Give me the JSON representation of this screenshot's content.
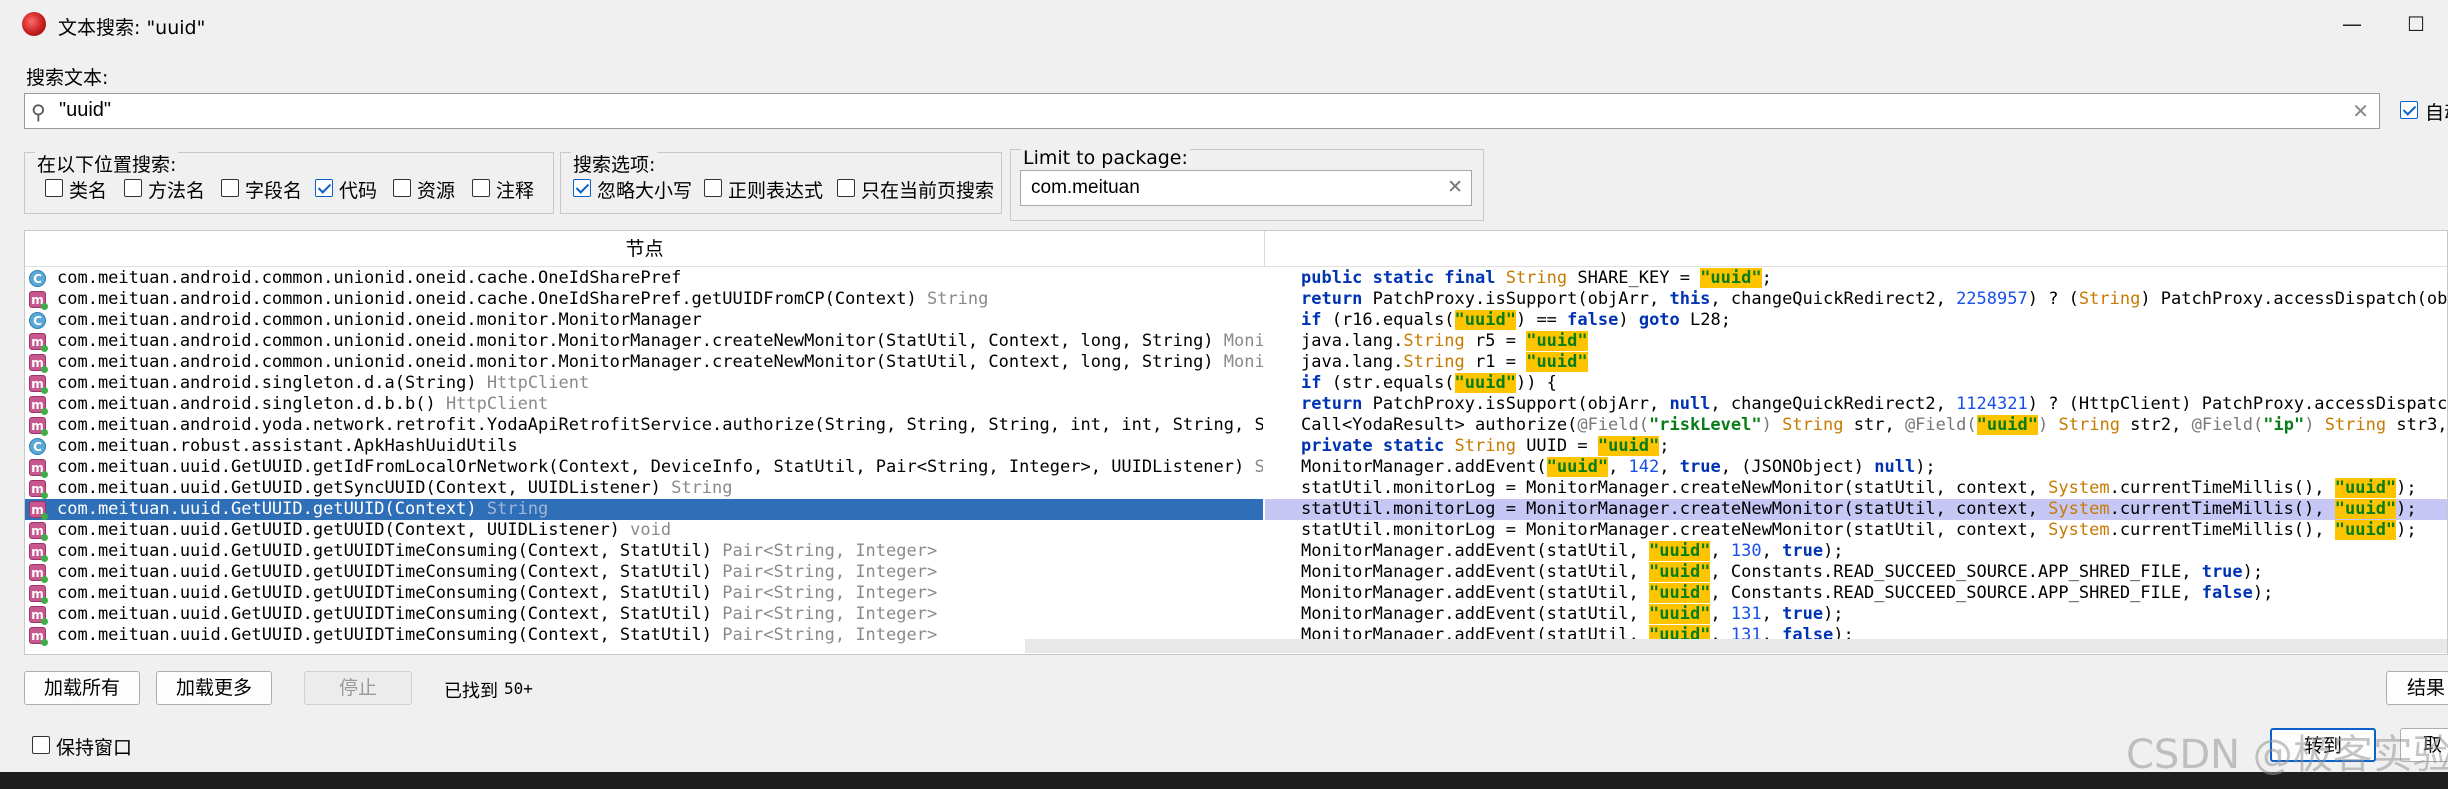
{
  "window": {
    "title": "文本搜索: \"uuid\"",
    "minimize_glyph": "—",
    "maximize_glyph": "☐"
  },
  "search": {
    "label": "搜索文本:",
    "value": "\"uuid\"",
    "auto_label": "自动"
  },
  "search_in": {
    "title": "在以下位置搜索:",
    "options": [
      {
        "label": "类名",
        "checked": false
      },
      {
        "label": "方法名",
        "checked": false
      },
      {
        "label": "字段名",
        "checked": false
      },
      {
        "label": "代码",
        "checked": true
      },
      {
        "label": "资源",
        "checked": false
      },
      {
        "label": "注释",
        "checked": false
      }
    ]
  },
  "search_options": {
    "title": "搜索选项:",
    "options": [
      {
        "label": "忽略大小写",
        "checked": true
      },
      {
        "label": "正则表达式",
        "checked": false
      },
      {
        "label": "只在当前页搜索",
        "checked": false
      }
    ]
  },
  "package": {
    "title": "Limit to package:",
    "value": "com.meituan"
  },
  "results": {
    "column_node": "节点",
    "selected_index": 11,
    "rows": [
      {
        "icon": "class",
        "name": "com.meituan.android.common.unionid.oneid.cache.OneIdSharePref",
        "type": ""
      },
      {
        "icon": "method",
        "name": "com.meituan.android.common.unionid.oneid.cache.OneIdSharePref.getUUIDFromCP(Context)",
        "type": "String"
      },
      {
        "icon": "class",
        "name": "com.meituan.android.common.unionid.oneid.monitor.MonitorManager",
        "type": ""
      },
      {
        "icon": "method",
        "name": "com.meituan.android.common.unionid.oneid.monitor.MonitorManager.createNewMonitor(StatUtil, Context, long, String)",
        "type": "Monitor"
      },
      {
        "icon": "method",
        "name": "com.meituan.android.common.unionid.oneid.monitor.MonitorManager.createNewMonitor(StatUtil, Context, long, String)",
        "type": "Monitor"
      },
      {
        "icon": "method",
        "name": "com.meituan.android.singleton.d.a(String)",
        "type": "HttpClient"
      },
      {
        "icon": "method",
        "name": "com.meituan.android.singleton.d.b.b()",
        "type": "HttpClient"
      },
      {
        "icon": "method",
        "name": "com.meituan.android.yoda.network.retrofit.YodaApiRetrofitService.authorize(String, String, String, int, int, String, Stri",
        "type": ""
      },
      {
        "icon": "class",
        "name": "com.meituan.robust.assistant.ApkHashUuidUtils",
        "type": ""
      },
      {
        "icon": "method",
        "name": "com.meituan.uuid.GetUUID.getIdFromLocalOrNetwork(Context, DeviceInfo, StatUtil, Pair<String, Integer>, UUIDListener)",
        "type": "Stri"
      },
      {
        "icon": "method",
        "name": "com.meituan.uuid.GetUUID.getSyncUUID(Context, UUIDListener)",
        "type": "String"
      },
      {
        "icon": "method",
        "name": "com.meituan.uuid.GetUUID.getUUID(Context)",
        "type": "String"
      },
      {
        "icon": "method",
        "name": "com.meituan.uuid.GetUUID.getUUID(Context, UUIDListener)",
        "type": "void"
      },
      {
        "icon": "method",
        "name": "com.meituan.uuid.GetUUID.getUUIDTimeConsuming(Context, StatUtil)",
        "type": "Pair<String, Integer>"
      },
      {
        "icon": "method",
        "name": "com.meituan.uuid.GetUUID.getUUIDTimeConsuming(Context, StatUtil)",
        "type": "Pair<String, Integer>"
      },
      {
        "icon": "method",
        "name": "com.meituan.uuid.GetUUID.getUUIDTimeConsuming(Context, StatUtil)",
        "type": "Pair<String, Integer>"
      },
      {
        "icon": "method",
        "name": "com.meituan.uuid.GetUUID.getUUIDTimeConsuming(Context, StatUtil)",
        "type": "Pair<String, Integer>"
      },
      {
        "icon": "method",
        "name": "com.meituan.uuid.GetUUID.getUUIDTimeConsuming(Context, StatUtil)",
        "type": "Pair<String, Integer>"
      }
    ],
    "code": [
      [
        [
          "kw",
          "public static final "
        ],
        [
          "ty",
          "String"
        ],
        [
          "t",
          " SHARE_KEY = "
        ],
        [
          "hl",
          "\"uuid\""
        ],
        [
          "t",
          ";"
        ]
      ],
      [
        [
          "kw",
          "return "
        ],
        [
          "t",
          "PatchProxy.isSupport(objArr, "
        ],
        [
          "kw",
          "this"
        ],
        [
          "t",
          ", changeQuickRedirect2, "
        ],
        [
          "num",
          "2258957"
        ],
        [
          "t",
          ") ? ("
        ],
        [
          "ty",
          "String"
        ],
        [
          "t",
          ") PatchProxy.accessDispatch(objArr"
        ]
      ],
      [
        [
          "kw",
          "if "
        ],
        [
          "t",
          "(r16.equals("
        ],
        [
          "hl",
          "\"uuid\""
        ],
        [
          "t",
          ") == "
        ],
        [
          "kw",
          "false"
        ],
        [
          "t",
          ") "
        ],
        [
          "kw",
          "goto"
        ],
        [
          "t",
          " L28;"
        ]
      ],
      [
        [
          "t",
          "java.lang."
        ],
        [
          "ty",
          "String"
        ],
        [
          "t",
          " r5 = "
        ],
        [
          "hl",
          "\"uuid\""
        ]
      ],
      [
        [
          "t",
          "java.lang."
        ],
        [
          "ty",
          "String"
        ],
        [
          "t",
          " r1 = "
        ],
        [
          "hl",
          "\"uuid\""
        ]
      ],
      [
        [
          "kw",
          "if "
        ],
        [
          "t",
          "(str.equals("
        ],
        [
          "hl",
          "\"uuid\""
        ],
        [
          "t",
          ")) {"
        ]
      ],
      [
        [
          "kw",
          "return "
        ],
        [
          "t",
          "PatchProxy.isSupport(objArr, "
        ],
        [
          "kw",
          "null"
        ],
        [
          "t",
          ", changeQuickRedirect2, "
        ],
        [
          "num",
          "1124321"
        ],
        [
          "t",
          ") ? (HttpClient) PatchProxy.accessDispatch(ob"
        ]
      ],
      [
        [
          "t",
          "Call<YodaResult> authorize("
        ],
        [
          "ann",
          "@Field("
        ],
        [
          "str",
          "\"riskLevel\""
        ],
        [
          "ann",
          ")"
        ],
        [
          "t",
          " "
        ],
        [
          "ty",
          "String"
        ],
        [
          "t",
          " str, "
        ],
        [
          "ann",
          "@Field("
        ],
        [
          "hl",
          "\"uuid\""
        ],
        [
          "ann",
          ")"
        ],
        [
          "t",
          " "
        ],
        [
          "ty",
          "String"
        ],
        [
          "t",
          " str2, "
        ],
        [
          "ann",
          "@Field("
        ],
        [
          "str",
          "\"ip\""
        ],
        [
          "ann",
          ")"
        ],
        [
          "t",
          " "
        ],
        [
          "ty",
          "String"
        ],
        [
          "t",
          " str3, "
        ],
        [
          "ann",
          "@Fi"
        ]
      ],
      [
        [
          "kw",
          "private static "
        ],
        [
          "ty",
          "String"
        ],
        [
          "t",
          " UUID = "
        ],
        [
          "hl",
          "\"uuid\""
        ],
        [
          "t",
          ";"
        ]
      ],
      [
        [
          "t",
          "MonitorManager.addEvent("
        ],
        [
          "hl",
          "\"uuid\""
        ],
        [
          "t",
          ", "
        ],
        [
          "num",
          "142"
        ],
        [
          "t",
          ", "
        ],
        [
          "kw",
          "true"
        ],
        [
          "t",
          ", (JSONObject) "
        ],
        [
          "kw",
          "null"
        ],
        [
          "t",
          ");"
        ]
      ],
      [
        [
          "t",
          "statUtil.monitorLog = MonitorManager.createNewMonitor(statUtil, context, "
        ],
        [
          "ty",
          "System"
        ],
        [
          "t",
          ".currentTimeMillis(), "
        ],
        [
          "hl",
          "\"uuid\""
        ],
        [
          "t",
          ");"
        ]
      ],
      [
        [
          "t",
          "statUtil.monitorLog = MonitorManager.createNewMonitor(statUtil, context, "
        ],
        [
          "ty",
          "System"
        ],
        [
          "t",
          ".currentTimeMillis(), "
        ],
        [
          "hl",
          "\"uuid\""
        ],
        [
          "t",
          ");"
        ]
      ],
      [
        [
          "t",
          "statUtil.monitorLog = MonitorManager.createNewMonitor(statUtil, context, "
        ],
        [
          "ty",
          "System"
        ],
        [
          "t",
          ".currentTimeMillis(), "
        ],
        [
          "hl",
          "\"uuid\""
        ],
        [
          "t",
          ");"
        ]
      ],
      [
        [
          "t",
          "MonitorManager.addEvent(statUtil, "
        ],
        [
          "hl",
          "\"uuid\""
        ],
        [
          "t",
          ", "
        ],
        [
          "num",
          "130"
        ],
        [
          "t",
          ", "
        ],
        [
          "kw",
          "true"
        ],
        [
          "t",
          ");"
        ]
      ],
      [
        [
          "t",
          "MonitorManager.addEvent(statUtil, "
        ],
        [
          "hl",
          "\"uuid\""
        ],
        [
          "t",
          ", Constants.READ_SUCCEED_SOURCE.APP_SHRED_FILE, "
        ],
        [
          "kw",
          "true"
        ],
        [
          "t",
          ");"
        ]
      ],
      [
        [
          "t",
          "MonitorManager.addEvent(statUtil, "
        ],
        [
          "hl",
          "\"uuid\""
        ],
        [
          "t",
          ", Constants.READ_SUCCEED_SOURCE.APP_SHRED_FILE, "
        ],
        [
          "kw",
          "false"
        ],
        [
          "t",
          ");"
        ]
      ],
      [
        [
          "t",
          "MonitorManager.addEvent(statUtil, "
        ],
        [
          "hl",
          "\"uuid\""
        ],
        [
          "t",
          ", "
        ],
        [
          "num",
          "131"
        ],
        [
          "t",
          ", "
        ],
        [
          "kw",
          "true"
        ],
        [
          "t",
          ");"
        ]
      ],
      [
        [
          "t",
          "MonitorManager.addEvent(statUtil, "
        ],
        [
          "hl",
          "\"uuid\""
        ],
        [
          "t",
          ", "
        ],
        [
          "num",
          "131"
        ],
        [
          "t",
          ", "
        ],
        [
          "kw",
          "false"
        ],
        [
          "t",
          ");"
        ]
      ]
    ]
  },
  "footer": {
    "load_all": "加载所有",
    "load_more": "加载更多",
    "stop": "停止",
    "found_label": "已找到",
    "found_count": "50+",
    "results_btn": "结果",
    "keep_window": "保持窗口",
    "goto_btn": "转到",
    "cancel_btn": "取"
  },
  "watermark": "CSDN @极客实验"
}
